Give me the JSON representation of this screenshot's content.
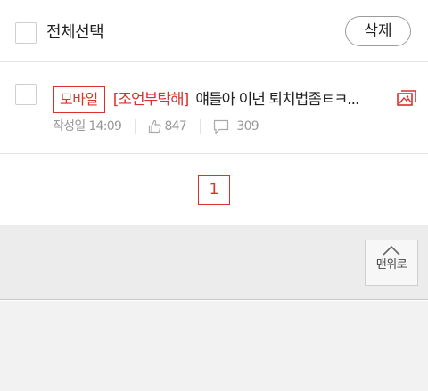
{
  "toolbar": {
    "select_all_label": "전체선택",
    "delete_label": "삭제"
  },
  "post": {
    "badge": "모바일",
    "category": "[조언부탁해]",
    "title": "얘들아 이년 퇴치법좀ㅌㅋ...",
    "date_label": "작성일",
    "time": "14:09",
    "likes": "847",
    "comments": "309",
    "icons": [
      "image-icon",
      "thumbs-up-icon",
      "comment-icon"
    ]
  },
  "pagination": {
    "current_page": "1"
  },
  "footer": {
    "to_top_label": "맨위로",
    "icon": "chevron-up-icon"
  },
  "colors": {
    "accent": "#d9312b",
    "meta_text": "#999999",
    "panel_bg": "#ececec"
  }
}
